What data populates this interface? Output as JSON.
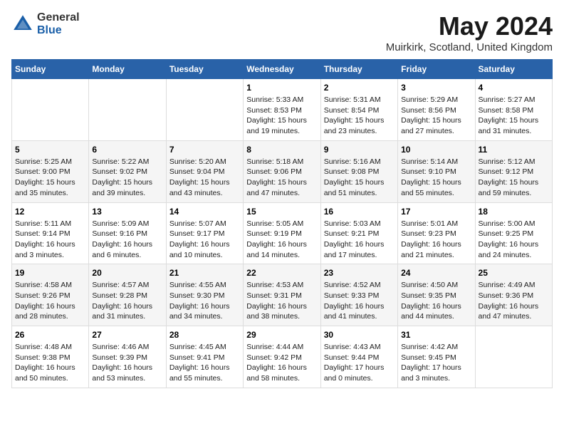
{
  "header": {
    "logo_general": "General",
    "logo_blue": "Blue",
    "month_title": "May 2024",
    "location": "Muirkirk, Scotland, United Kingdom"
  },
  "weekdays": [
    "Sunday",
    "Monday",
    "Tuesday",
    "Wednesday",
    "Thursday",
    "Friday",
    "Saturday"
  ],
  "weeks": [
    [
      {
        "day": "",
        "detail": ""
      },
      {
        "day": "",
        "detail": ""
      },
      {
        "day": "",
        "detail": ""
      },
      {
        "day": "1",
        "detail": "Sunrise: 5:33 AM\nSunset: 8:53 PM\nDaylight: 15 hours\nand 19 minutes."
      },
      {
        "day": "2",
        "detail": "Sunrise: 5:31 AM\nSunset: 8:54 PM\nDaylight: 15 hours\nand 23 minutes."
      },
      {
        "day": "3",
        "detail": "Sunrise: 5:29 AM\nSunset: 8:56 PM\nDaylight: 15 hours\nand 27 minutes."
      },
      {
        "day": "4",
        "detail": "Sunrise: 5:27 AM\nSunset: 8:58 PM\nDaylight: 15 hours\nand 31 minutes."
      }
    ],
    [
      {
        "day": "5",
        "detail": "Sunrise: 5:25 AM\nSunset: 9:00 PM\nDaylight: 15 hours\nand 35 minutes."
      },
      {
        "day": "6",
        "detail": "Sunrise: 5:22 AM\nSunset: 9:02 PM\nDaylight: 15 hours\nand 39 minutes."
      },
      {
        "day": "7",
        "detail": "Sunrise: 5:20 AM\nSunset: 9:04 PM\nDaylight: 15 hours\nand 43 minutes."
      },
      {
        "day": "8",
        "detail": "Sunrise: 5:18 AM\nSunset: 9:06 PM\nDaylight: 15 hours\nand 47 minutes."
      },
      {
        "day": "9",
        "detail": "Sunrise: 5:16 AM\nSunset: 9:08 PM\nDaylight: 15 hours\nand 51 minutes."
      },
      {
        "day": "10",
        "detail": "Sunrise: 5:14 AM\nSunset: 9:10 PM\nDaylight: 15 hours\nand 55 minutes."
      },
      {
        "day": "11",
        "detail": "Sunrise: 5:12 AM\nSunset: 9:12 PM\nDaylight: 15 hours\nand 59 minutes."
      }
    ],
    [
      {
        "day": "12",
        "detail": "Sunrise: 5:11 AM\nSunset: 9:14 PM\nDaylight: 16 hours\nand 3 minutes."
      },
      {
        "day": "13",
        "detail": "Sunrise: 5:09 AM\nSunset: 9:16 PM\nDaylight: 16 hours\nand 6 minutes."
      },
      {
        "day": "14",
        "detail": "Sunrise: 5:07 AM\nSunset: 9:17 PM\nDaylight: 16 hours\nand 10 minutes."
      },
      {
        "day": "15",
        "detail": "Sunrise: 5:05 AM\nSunset: 9:19 PM\nDaylight: 16 hours\nand 14 minutes."
      },
      {
        "day": "16",
        "detail": "Sunrise: 5:03 AM\nSunset: 9:21 PM\nDaylight: 16 hours\nand 17 minutes."
      },
      {
        "day": "17",
        "detail": "Sunrise: 5:01 AM\nSunset: 9:23 PM\nDaylight: 16 hours\nand 21 minutes."
      },
      {
        "day": "18",
        "detail": "Sunrise: 5:00 AM\nSunset: 9:25 PM\nDaylight: 16 hours\nand 24 minutes."
      }
    ],
    [
      {
        "day": "19",
        "detail": "Sunrise: 4:58 AM\nSunset: 9:26 PM\nDaylight: 16 hours\nand 28 minutes."
      },
      {
        "day": "20",
        "detail": "Sunrise: 4:57 AM\nSunset: 9:28 PM\nDaylight: 16 hours\nand 31 minutes."
      },
      {
        "day": "21",
        "detail": "Sunrise: 4:55 AM\nSunset: 9:30 PM\nDaylight: 16 hours\nand 34 minutes."
      },
      {
        "day": "22",
        "detail": "Sunrise: 4:53 AM\nSunset: 9:31 PM\nDaylight: 16 hours\nand 38 minutes."
      },
      {
        "day": "23",
        "detail": "Sunrise: 4:52 AM\nSunset: 9:33 PM\nDaylight: 16 hours\nand 41 minutes."
      },
      {
        "day": "24",
        "detail": "Sunrise: 4:50 AM\nSunset: 9:35 PM\nDaylight: 16 hours\nand 44 minutes."
      },
      {
        "day": "25",
        "detail": "Sunrise: 4:49 AM\nSunset: 9:36 PM\nDaylight: 16 hours\nand 47 minutes."
      }
    ],
    [
      {
        "day": "26",
        "detail": "Sunrise: 4:48 AM\nSunset: 9:38 PM\nDaylight: 16 hours\nand 50 minutes."
      },
      {
        "day": "27",
        "detail": "Sunrise: 4:46 AM\nSunset: 9:39 PM\nDaylight: 16 hours\nand 53 minutes."
      },
      {
        "day": "28",
        "detail": "Sunrise: 4:45 AM\nSunset: 9:41 PM\nDaylight: 16 hours\nand 55 minutes."
      },
      {
        "day": "29",
        "detail": "Sunrise: 4:44 AM\nSunset: 9:42 PM\nDaylight: 16 hours\nand 58 minutes."
      },
      {
        "day": "30",
        "detail": "Sunrise: 4:43 AM\nSunset: 9:44 PM\nDaylight: 17 hours\nand 0 minutes."
      },
      {
        "day": "31",
        "detail": "Sunrise: 4:42 AM\nSunset: 9:45 PM\nDaylight: 17 hours\nand 3 minutes."
      },
      {
        "day": "",
        "detail": ""
      }
    ]
  ]
}
